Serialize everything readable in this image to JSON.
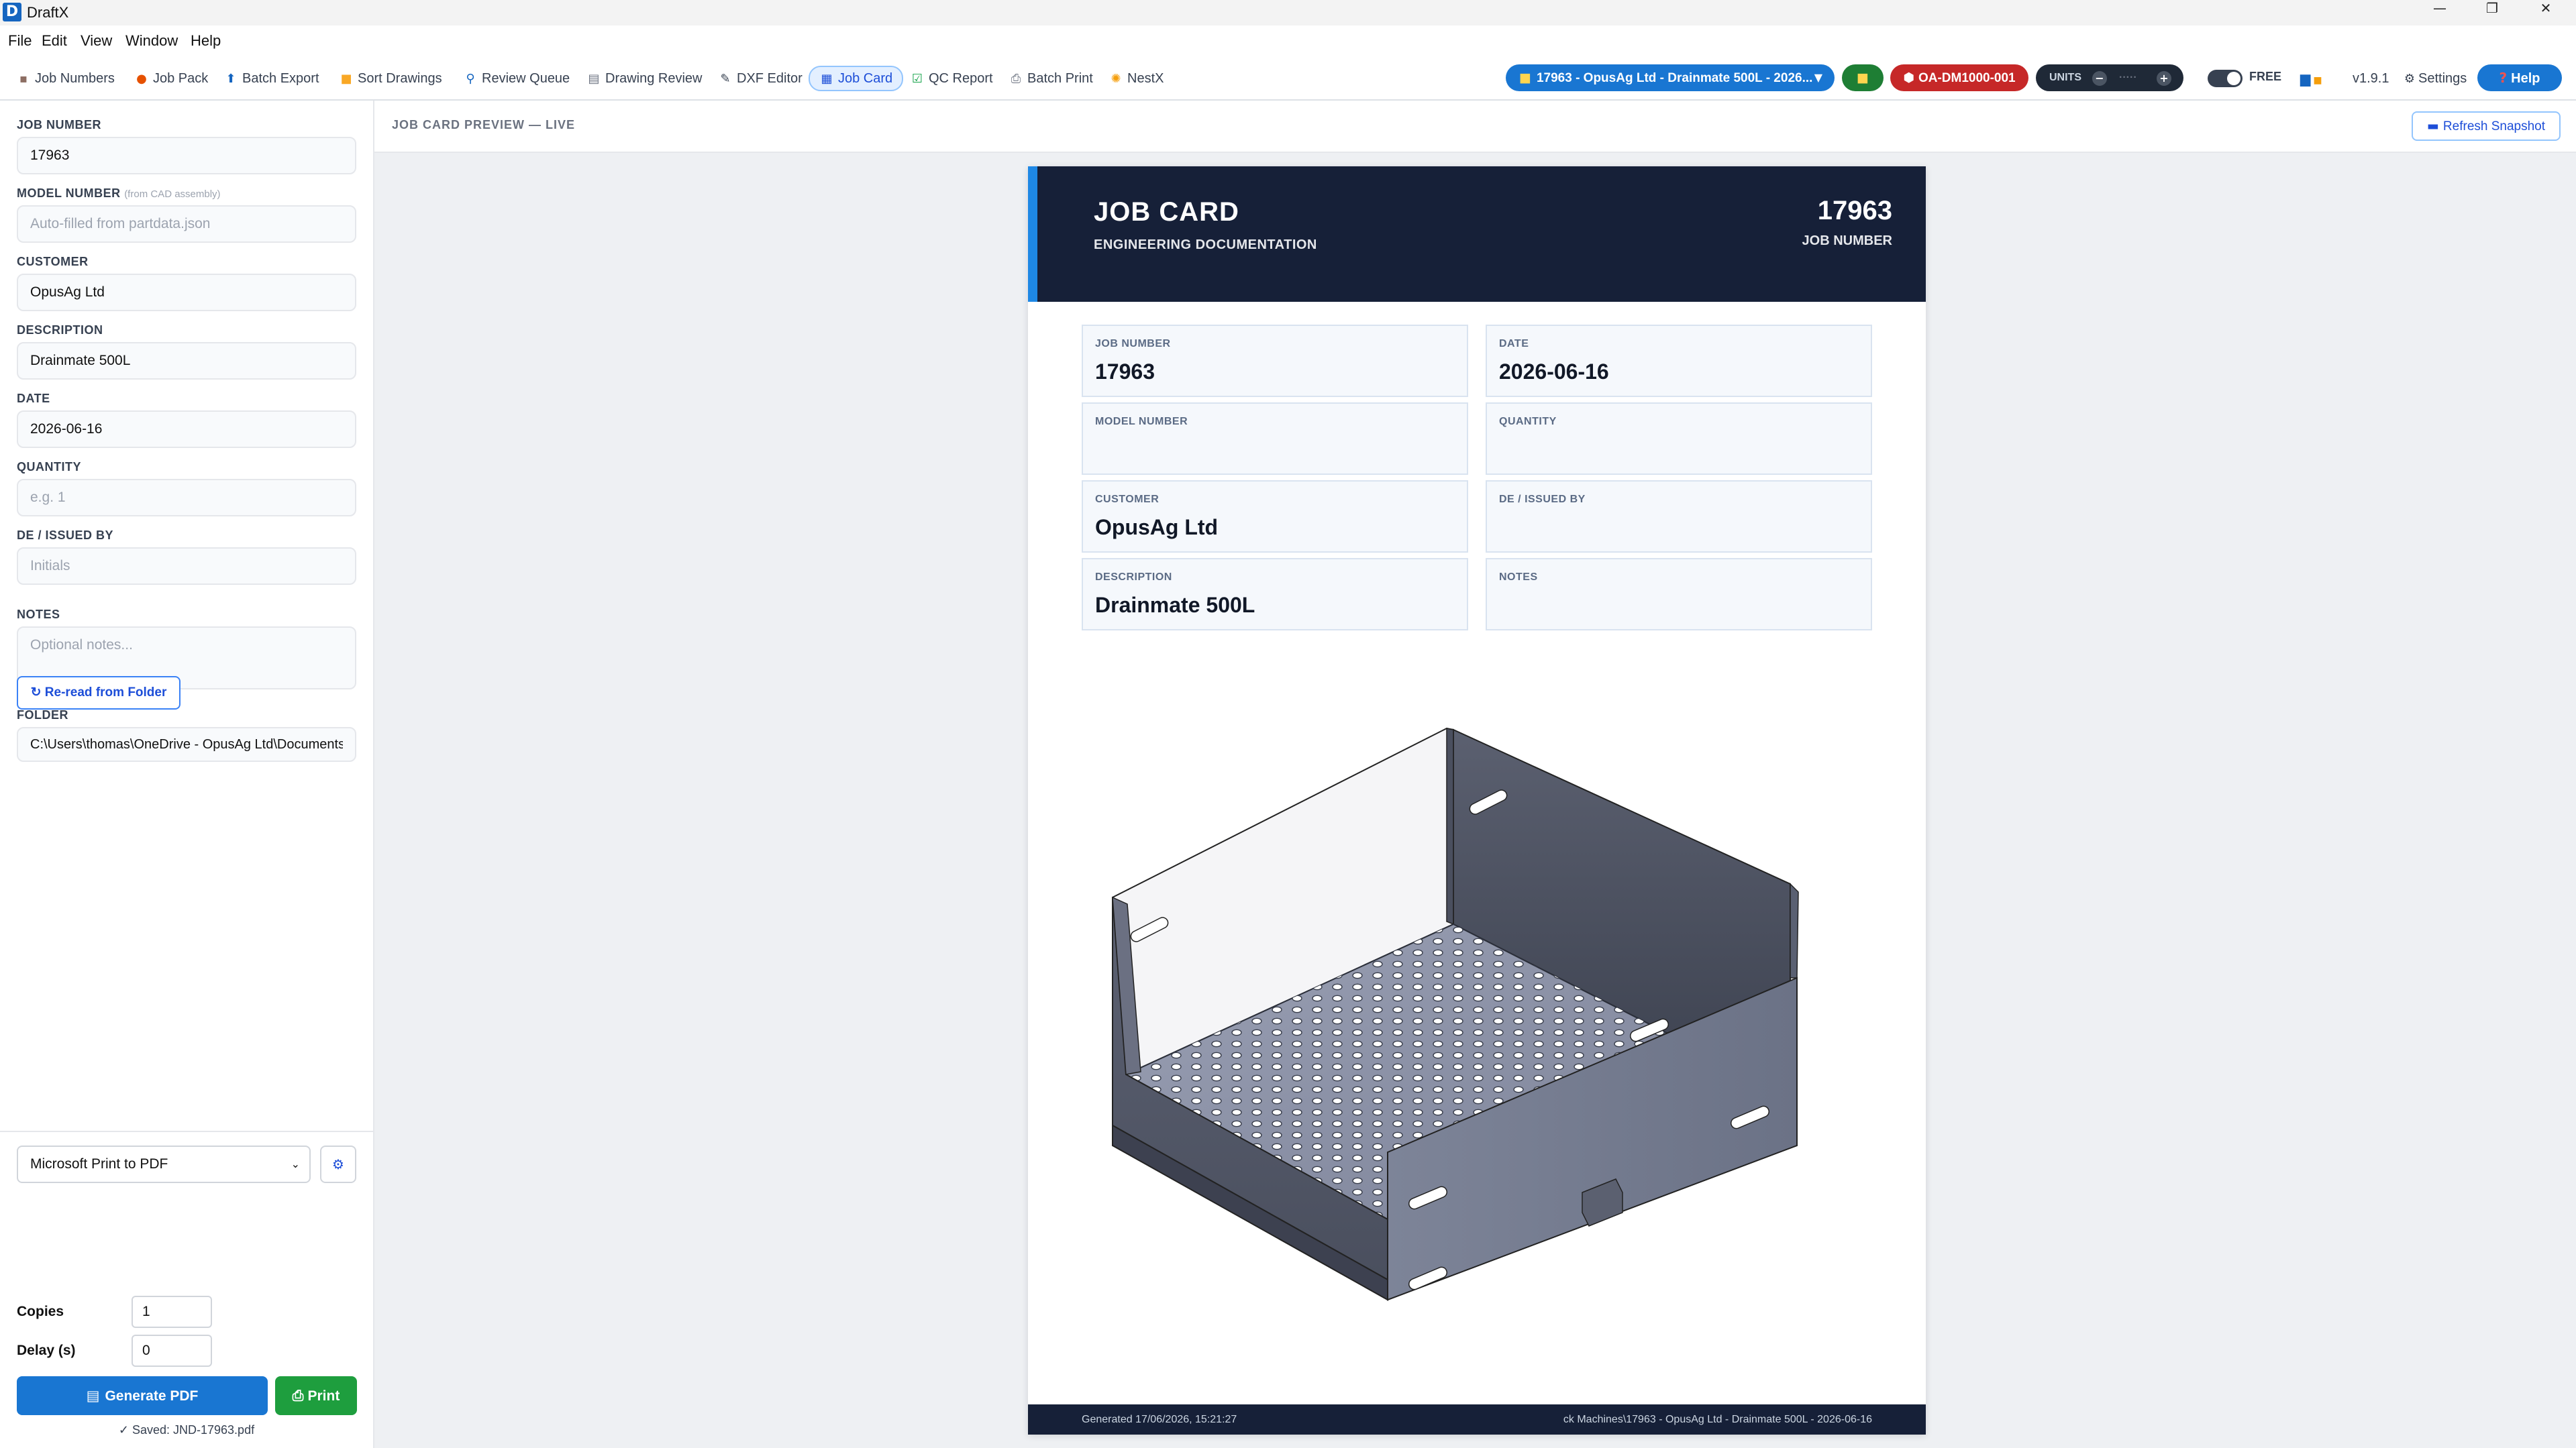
{
  "app": {
    "logo_letter": "D",
    "title": "DraftX"
  },
  "window_controls": {
    "minimize": "—",
    "restore": "❐",
    "close": "✕"
  },
  "menu": [
    "File",
    "Edit",
    "View",
    "Window",
    "Help"
  ],
  "toolbar": {
    "tools": [
      {
        "icon": "toolbox-icon",
        "label": "Job Numbers"
      },
      {
        "icon": "pack-icon",
        "label": "Job Pack"
      },
      {
        "icon": "export-icon",
        "label": "Batch Export"
      },
      {
        "icon": "folder-icon",
        "label": "Sort Drawings"
      },
      {
        "icon": "magnifier-icon",
        "label": "Review Queue"
      },
      {
        "icon": "document-icon",
        "label": "Drawing Review"
      },
      {
        "icon": "pencil-icon",
        "label": "DXF Editor"
      },
      {
        "icon": "clipboard-icon",
        "label": "Job Card"
      },
      {
        "icon": "checkbox-icon",
        "label": "QC Report"
      },
      {
        "icon": "printer-icon",
        "label": "Batch Print"
      },
      {
        "icon": "sparkle-icon",
        "label": "NestX"
      }
    ],
    "active_tool": "Job Card",
    "job_selector": "17963 - OpusAg Ltd - Drainmate 500L - 2026...",
    "part_badge": "OA-DM1000-001",
    "units_label": "UNITS",
    "units_minus": "−",
    "units_plus": "+",
    "free_label": "FREE",
    "version": "v1.9.1",
    "settings_label": "Settings",
    "help_label": "Help"
  },
  "form": {
    "job_number": {
      "label": "JOB NUMBER",
      "value": "17963"
    },
    "model_number": {
      "label": "MODEL NUMBER",
      "hint": "(from CAD assembly)",
      "placeholder": "Auto-filled from partdata.json"
    },
    "customer": {
      "label": "CUSTOMER",
      "value": "OpusAg Ltd"
    },
    "description": {
      "label": "DESCRIPTION",
      "value": "Drainmate 500L"
    },
    "date": {
      "label": "DATE",
      "value": "2026-06-16"
    },
    "quantity": {
      "label": "QUANTITY",
      "placeholder": "e.g. 1"
    },
    "issued_by": {
      "label": "DE / ISSUED BY",
      "placeholder": "Initials"
    },
    "notes": {
      "label": "NOTES",
      "placeholder": "Optional notes..."
    },
    "folder": {
      "label": "FOLDER",
      "value": "C:\\Users\\thomas\\OneDrive - OpusAg Ltd\\Documents"
    },
    "reread_label": "↻ Re-read from Folder"
  },
  "print_panel": {
    "printer": "Microsoft Print to PDF",
    "copies_label": "Copies",
    "copies": "1",
    "delay_label": "Delay (s)",
    "delay": "0",
    "generate_label": "Generate PDF",
    "print_label": "Print",
    "saved_note": "✓ Saved: JND-17963.pdf"
  },
  "preview": {
    "title": "JOB CARD PREVIEW — LIVE",
    "refresh_label": "Refresh Snapshot",
    "card": {
      "title": "JOB CARD",
      "subtitle": "ENGINEERING DOCUMENTATION",
      "job_number": "17963",
      "job_number_label": "JOB NUMBER",
      "cells": [
        {
          "label": "JOB NUMBER",
          "value": "17963"
        },
        {
          "label": "DATE",
          "value": "2026-06-16"
        },
        {
          "label": "MODEL NUMBER",
          "value": ""
        },
        {
          "label": "QUANTITY",
          "value": ""
        },
        {
          "label": "CUSTOMER",
          "value": "OpusAg Ltd"
        },
        {
          "label": "DE / ISSUED BY",
          "value": ""
        },
        {
          "label": "DESCRIPTION",
          "value": "Drainmate 500L"
        },
        {
          "label": "NOTES",
          "value": ""
        }
      ],
      "footer_left": "Generated 17/06/2026, 15:21:27",
      "footer_right": "ck Machines\\17963 - OpusAg Ltd - Drainmate 500L - 2026-06-16"
    }
  },
  "colors": {
    "accent": "#1976d2",
    "card_header": "#162038",
    "part_badge": "#c62828",
    "print_green": "#1e9e3e"
  }
}
